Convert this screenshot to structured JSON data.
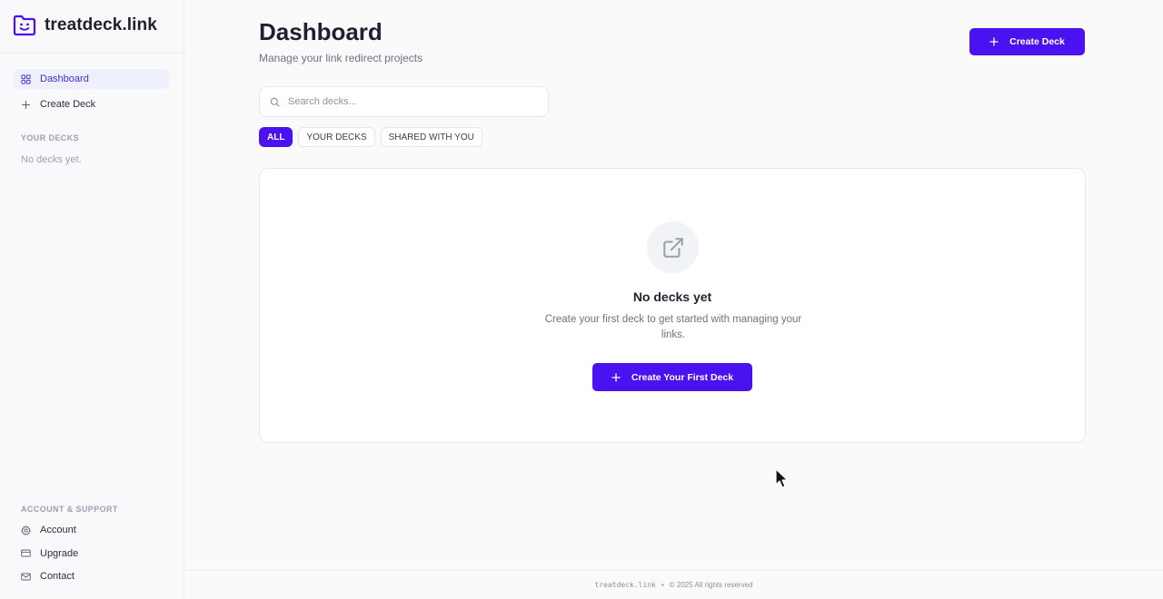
{
  "brand": {
    "name": "treatdeck.link",
    "accent": "#4a12f0"
  },
  "sidebar": {
    "nav": [
      {
        "label": "Dashboard",
        "icon": "grid-icon",
        "active": true
      },
      {
        "label": "Create Deck",
        "icon": "plus-icon",
        "active": false
      }
    ],
    "decks_heading": "YOUR DECKS",
    "decks_empty": "No decks yet.",
    "support_heading": "ACCOUNT & SUPPORT",
    "support": [
      {
        "label": "Account",
        "icon": "gear-icon"
      },
      {
        "label": "Upgrade",
        "icon": "credit-card-icon"
      },
      {
        "label": "Contact",
        "icon": "mail-icon"
      }
    ]
  },
  "header": {
    "title": "Dashboard",
    "subtitle": "Manage your link redirect projects",
    "create_label": "Create Deck"
  },
  "search": {
    "placeholder": "Search decks...",
    "value": ""
  },
  "filters": [
    {
      "label": "ALL",
      "active": true
    },
    {
      "label": "YOUR DECKS",
      "active": false
    },
    {
      "label": "SHARED WITH YOU",
      "active": false
    }
  ],
  "empty_state": {
    "icon": "external-link-icon",
    "title": "No decks yet",
    "description": "Create your first deck to get started with managing your links.",
    "cta_label": "Create Your First Deck"
  },
  "footer": {
    "site": "treatdeck.link",
    "separator": "•",
    "copyright": "© 2025 All rights reserved"
  }
}
